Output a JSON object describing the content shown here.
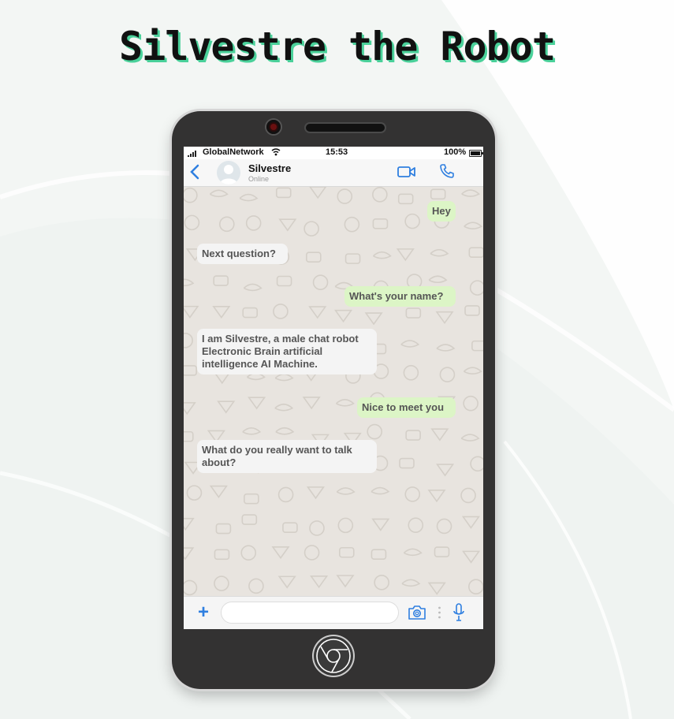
{
  "page_title": "Silvestre the Robot",
  "status_bar": {
    "carrier": "GlobalNetwork",
    "time": "15:53",
    "battery": "100%"
  },
  "chat_header": {
    "contact_name": "Silvestre",
    "contact_status": "Online"
  },
  "messages": [
    {
      "direction": "out",
      "text": "Hey"
    },
    {
      "direction": "in",
      "text": "Next question?"
    },
    {
      "direction": "out",
      "text": "What's your name?"
    },
    {
      "direction": "in",
      "text": "I am Silvestre, a male chat robot Electronic Brain artificial intelligence AI Machine."
    },
    {
      "direction": "out",
      "text": "Nice to meet you"
    },
    {
      "direction": "in",
      "text": "What do you really want to talk about?"
    }
  ],
  "input_bar": {
    "value": "",
    "placeholder": ""
  },
  "icons": {
    "back": "chevron-left-icon",
    "video": "video-camera-icon",
    "call": "phone-icon",
    "add": "plus-icon",
    "camera": "camera-icon",
    "mic": "microphone-icon",
    "home": "chrome-logo-icon"
  },
  "colors": {
    "accent": "#2f7fe0",
    "outgoing_bubble": "#dcf5c6",
    "incoming_bubble": "#f4f4f4",
    "title_shadow": "#4ad19a",
    "phone_body": "#333232"
  }
}
